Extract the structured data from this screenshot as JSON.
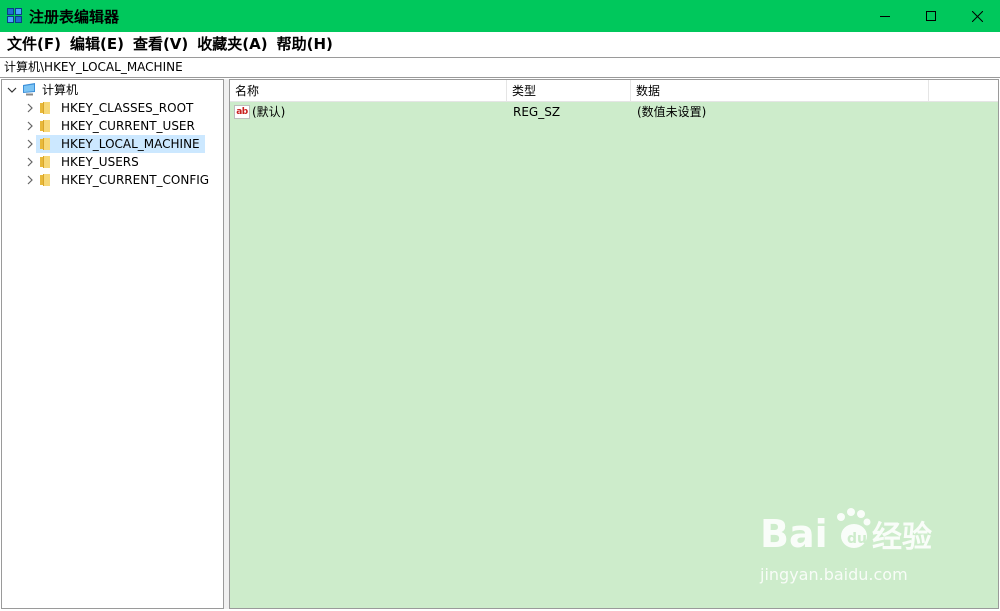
{
  "window": {
    "title": "注册表编辑器",
    "app_icon": "regedit-icon",
    "controls": [
      "minimize-icon",
      "maximize-icon",
      "close-icon"
    ]
  },
  "menu": {
    "items": [
      "文件(F)",
      "编辑(E)",
      "查看(V)",
      "收藏夹(A)",
      "帮助(H)"
    ]
  },
  "address": {
    "path": "计算机\\HKEY_LOCAL_MACHINE"
  },
  "tree": {
    "root": "计算机",
    "items": [
      {
        "label": "HKEY_CLASSES_ROOT",
        "selected": false
      },
      {
        "label": "HKEY_CURRENT_USER",
        "selected": false
      },
      {
        "label": "HKEY_LOCAL_MACHINE",
        "selected": true
      },
      {
        "label": "HKEY_USERS",
        "selected": false
      },
      {
        "label": "HKEY_CURRENT_CONFIG",
        "selected": false
      }
    ]
  },
  "list": {
    "columns": [
      "名称",
      "类型",
      "数据"
    ],
    "rows": [
      {
        "name": "(默认)",
        "type": "REG_SZ",
        "data": "(数值未设置)",
        "icon": "string-value-icon"
      }
    ]
  },
  "watermark": {
    "logo": "Bai du 经验",
    "url": "jingyan.baidu.com"
  },
  "colors": {
    "titlebar": "#00c85c",
    "list_background": "#cdeccb",
    "selection": "#cce8ff"
  }
}
